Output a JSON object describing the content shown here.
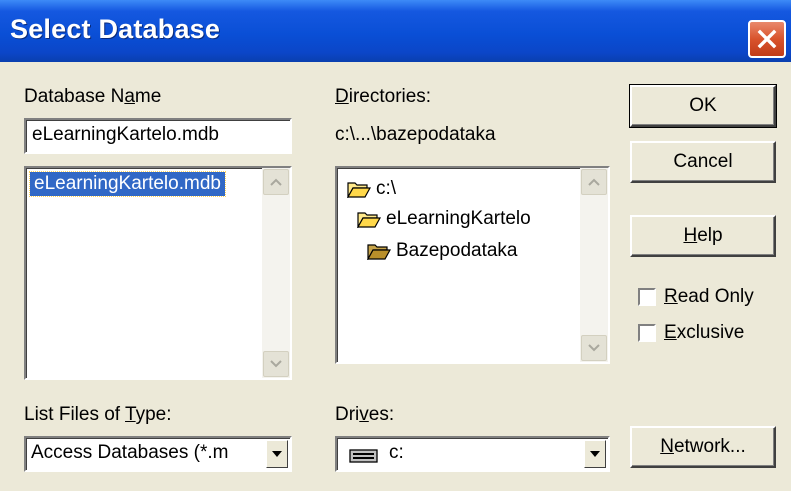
{
  "window": {
    "title": "Select Database",
    "close_icon": "close-icon",
    "colors": {
      "titlebar": "#0a4fd6",
      "close_button": "#d9532c",
      "selection": "#3168c6",
      "dialog_bg": "#ece9d8"
    }
  },
  "database_name": {
    "label_pre": "Database N",
    "label_key": "a",
    "label_post": "me",
    "value": "eLearningKartelo.mdb"
  },
  "files_list": {
    "items": [
      "eLearningKartelo.mdb"
    ],
    "selected": "eLearningKartelo.mdb"
  },
  "directories": {
    "label_key": "D",
    "label_post": "irectories:",
    "current_path": "c:\\...\\bazepodataka",
    "items": [
      {
        "name": "c:\\",
        "icon": "open-folder-icon"
      },
      {
        "name": "eLearningKartelo",
        "icon": "open-folder-icon"
      },
      {
        "name": "Bazepodataka",
        "icon": "open-folder-icon"
      }
    ]
  },
  "buttons": {
    "ok": "OK",
    "cancel": "Cancel",
    "help_key": "H",
    "help_post": "elp",
    "network_key": "N",
    "network_post": "etwork..."
  },
  "options": {
    "read_only_key": "R",
    "read_only_post": "ead Only",
    "read_only_checked": false,
    "exclusive_key": "E",
    "exclusive_post": "xclusive",
    "exclusive_checked": false
  },
  "file_type": {
    "label_pre": "List Files of ",
    "label_key": "T",
    "label_post": "ype:",
    "selected": "Access Databases (*.m"
  },
  "drives": {
    "label_pre": "Dri",
    "label_key": "v",
    "label_post": "es:",
    "selected": "c:",
    "icon": "drive-icon"
  }
}
